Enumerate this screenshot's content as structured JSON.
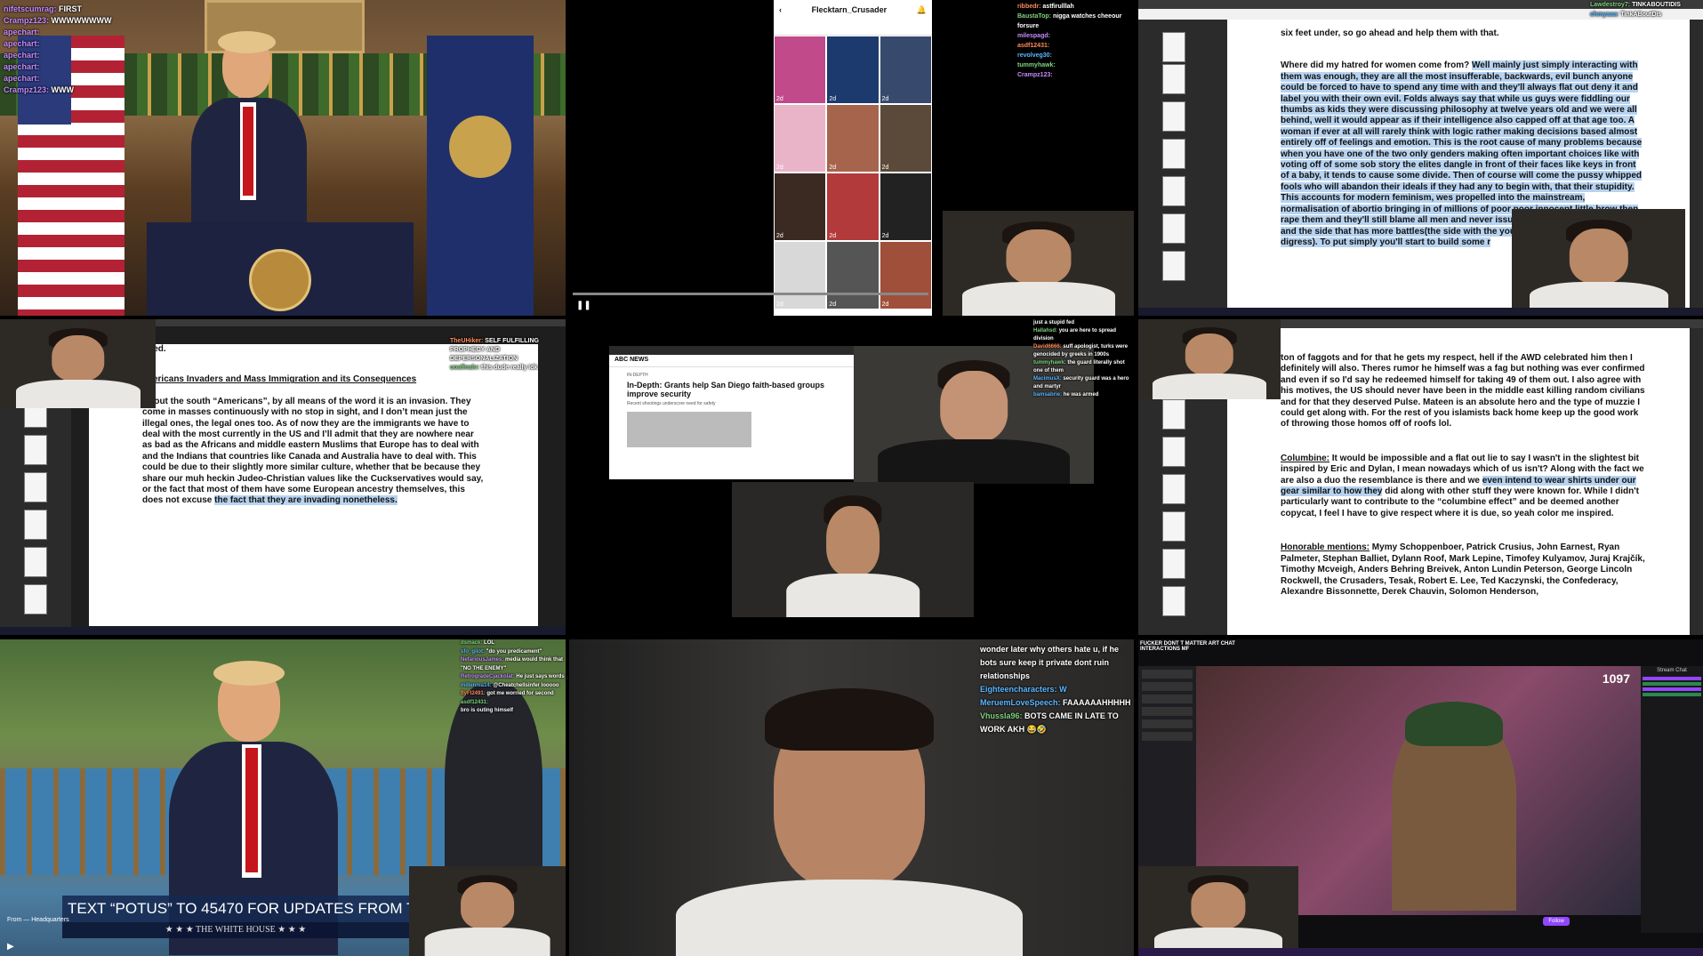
{
  "tile1": {
    "chat": [
      {
        "user": "nifetscumrag:",
        "msg": "FIRST"
      },
      {
        "user": "Crampz123:",
        "msg": "WWWWWWWW"
      },
      {
        "user": "apechart:",
        "msg": ""
      },
      {
        "user": "apechart:",
        "msg": ""
      },
      {
        "user": "apechart:",
        "msg": ""
      },
      {
        "user": "apechart:",
        "msg": ""
      },
      {
        "user": "apechart:",
        "msg": ""
      },
      {
        "user": "Crampz123:",
        "msg": "WWW"
      }
    ]
  },
  "tile2": {
    "profile_name": "Flecktarn_Crusader",
    "thumb_times": [
      "2d",
      "2d",
      "2d",
      "2d",
      "2d",
      "2d",
      "2d",
      "2d",
      "2d",
      "2d",
      "2d",
      "2d"
    ],
    "chat": [
      {
        "user": "ribbedr:",
        "msg": "astfirulllah"
      },
      {
        "user": "BaustaTop:",
        "msg": "nigga watches cheeour forsure"
      },
      {
        "user": "milespagd:",
        "msg": ""
      },
      {
        "user": "asdf12431:",
        "msg": ""
      },
      {
        "user": "revolveg30:",
        "msg": ""
      },
      {
        "user": "tummyhawk:",
        "msg": ""
      },
      {
        "user": "Crampz123:",
        "msg": ""
      }
    ]
  },
  "tile3": {
    "intro_line": "six feet under, so go ahead and help them with that.",
    "question": "Where did my hatred for women come from?",
    "body": "Well mainly just simply interacting with them was enough, they are all the most insufferable, backwards, evil bunch anyone could be forced to have to spend any time with and they'll always flat out deny it and label you with their own evil. Folds always say that while us guys were fiddling our thumbs as kids they were discussing philosophy at twelve years old and we were all behind, well it would appear as if their intelligence also capped off at that age too. A woman if ever at all will rarely think with logic rather making decisions based almost entirely off of feelings and emotion. This is the root cause of many problems because when you have one of the two only genders making often important choices like with voting off of some sob story the elites dangle in front of their faces like keys in front of a baby, it tends to cause some divide. Then of course will come the pussy whipped fools who will abandon their ideals if they had any to begin with, that their stupidity. This accounts for modern feminism, wes propelled into the mainstream, normalisation of abortio bringing in of millions of poor poor innocent little brow then rape them and they'll still blame all men and never issue). It really is all a cultural war and the side that has more battles(the side with the young men/youth in gene but I digress). To put simply you'll start to build some r",
    "chat": [
      {
        "user": "Lawdestroy7:",
        "msg": "TINKABOUTIDIS"
      },
      {
        "user": "chmyaaa:",
        "msg": "TinkABoutDis"
      }
    ]
  },
  "tile4": {
    "heading_fragment": "nged.",
    "section_title": "th Americans Invaders and Mass Immigration and its Consequences",
    "body": "About the south “Americans”, by all means of the word it is an invasion. They come in masses continuously with no stop in sight, and I don’t mean just the illegal ones, the legal ones too. As of now they are the immigrants we have to deal with the most currently in the US and I’ll admit that they are nowhere near as bad as the Africans and middle eastern Muslims that Europe has to deal with and the Indians that countries like Canada and Australia have to deal with. This could be due to their slightly more similar culture, whether that be because they share our muh heckin Judeo-Christian values like the Cuckservatives would say, or the fact that most of them have some European ancestry themselves, this does not excuse",
    "body_highlight": "the fact that they are invading nonetheless.",
    "chat": [
      {
        "user": "TheUHiker:",
        "msg": "SELF FULFILLING PROPHECY AND DEPERSONALIZATION"
      },
      {
        "user": "uoafinalv:",
        "msg": "this dude really idk"
      }
    ]
  },
  "tile5": {
    "news_source": "ABC NEWS",
    "article_kicker": "IN-DEPTH",
    "article_title": "In-Depth: Grants help San Diego faith-based groups improve security",
    "article_sub": "Recent shootings underscore need for safety",
    "chat": [
      {
        "user": "",
        "msg": "just a stupid fed"
      },
      {
        "user": "Hallahsd:",
        "msg": "you are here to spread division"
      },
      {
        "user": "David6666:",
        "msg": "suff apologist, turks were genocided by greeks in 1900s"
      },
      {
        "user": "tummyhawk:",
        "msg": "the guard literally shot one of them"
      },
      {
        "user": "MacimusX:",
        "msg": "security guard was a hero and martyr"
      },
      {
        "user": "bamsabrie:",
        "msg": "he was armed"
      }
    ]
  },
  "tile6": {
    "top_text": "ton of faggots and for that he gets my respect, hell if the AWD celebrated him then I definitely will also. Theres rumor he himself was a fag but nothing was ever confirmed and even if so I'd say he redeemed himself for taking 49 of them out. I also agree with his motives, the US should never have been in the middle east killing random civilians and for that they deserved Pulse. Mateen is an absolute hero and the type of muzzie I could get along with. For the rest of you islamists back home keep up the good work of throwing those homos off of roofs lol.",
    "columbine_label": "Columbine:",
    "columbine_text_a": "It would be impossible and a flat out lie to say I wasn't in the slightest bit inspired by Eric and Dylan, I mean nowadays which of us isn't? Along with the fact we are also a duo the resemblance is there and we",
    "columbine_highlight": "even intend to wear shirts under our gear similar to how they",
    "columbine_text_b": "did along with other stuff they were known for. While I didn't particularly want to contribute to the “columbine effect” and be deemed another copycat, I feel I have to give respect where it is due, so yeah color me inspired.",
    "honorable_label": "Honorable mentions:",
    "honorable_text": "Mymy Schoppenboer, Patrick Crusius, John Earnest, Ryan Palmeter, Stephan Balliet, Dylann Roof, Mark Lepine, Timofey Kulyamov, Juraj Krajčík, Timothy Mcveigh, Anders Behring Breivek, Anton Lundin Peterson, George Lincoln Rockwell, the Crusaders, Tesak, Robert E. Lee, Ted Kaczynski, the Confederacy, Alexandre Bissonnette, Derek Chauvin, Solomon Henderson,"
  },
  "tile7": {
    "banner": "TEXT “POTUS” TO 45470 FOR UPDATES FROM THE",
    "sub_banner": "★ ★ ★  THE WHITE HOUSE  ★ ★ ★",
    "from_label": "From",
    "from_value": "Headquarters",
    "chat": [
      {
        "user": "dsmack:",
        "msg": "LOL"
      },
      {
        "user": "sfo_gilot:",
        "msg": "\"do you predicament\""
      },
      {
        "user": "NefariousJames:",
        "msg": "media would think that"
      },
      {
        "user": "",
        "msg": "\"NO THE ENEMY\""
      },
      {
        "user": "RetrogradeCjackolat:",
        "msg": "He just says words"
      },
      {
        "user": "millennia14:",
        "msg": "@Cheatchellsinfer looooo"
      },
      {
        "user": "flyFI2491:",
        "msg": "got me worried for second"
      },
      {
        "user": "asdf12431:",
        "msg": ""
      },
      {
        "user": "",
        "msg": "bro is outing himself"
      }
    ]
  },
  "tile8": {
    "chat": [
      {
        "user": "",
        "msg": "wonder later why others hate u, if he bots sure keep it private dont ruin relationships"
      },
      {
        "user": "Eighteencharacters:",
        "msg": "W"
      },
      {
        "user": "MeruemLoveSpeech:",
        "msg": "FAAAAAAHHHHH"
      },
      {
        "user": "Vhussla96:",
        "msg": "BOTS CAME IN LATE TO WORK AKH 😂🤣"
      }
    ]
  },
  "tile9": {
    "header": "FUCKER DONT T MATTER ART CHAT",
    "header2": "INTERACTIONS MF",
    "viewer_count": "1097",
    "stream_chat_title": "Stream Chat",
    "follow_label": "Follow"
  },
  "colors": {
    "chat_name_purple": "#c58bff",
    "highlight_blue": "#b7d3f0",
    "twitch_purple": "#9147ff"
  }
}
